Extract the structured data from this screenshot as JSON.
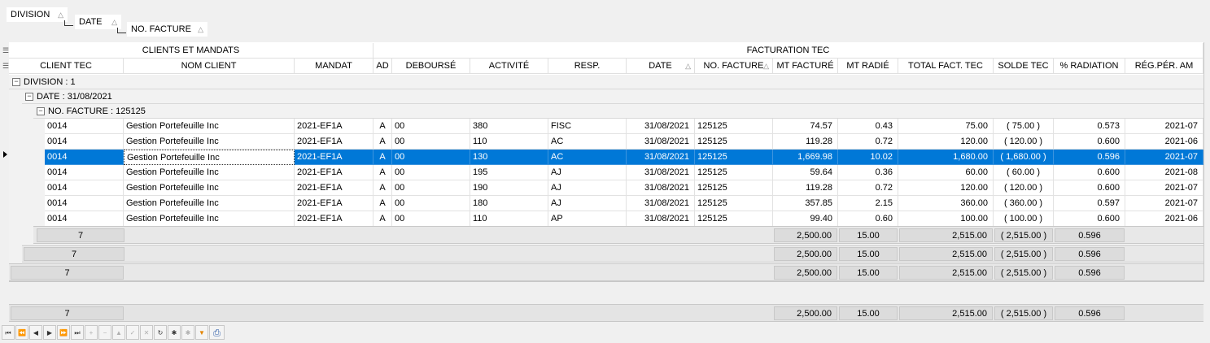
{
  "group_panel": {
    "division": "DIVISION",
    "date": "DATE",
    "no_facture": "NO. FACTURE"
  },
  "bands": {
    "clients": "CLIENTS ET MANDATS",
    "facturation": "FACTURATION TEC"
  },
  "columns": {
    "client_tec": "CLIENT TEC",
    "nom_client": "NOM CLIENT",
    "mandat": "MANDAT",
    "ad": "AD",
    "debourse": "DEBOURSÉ",
    "activite": "ACTIVITÉ",
    "resp": "RESP.",
    "date": "DATE",
    "no_facture": "NO. FACTURE",
    "mt_facture": "MT FACTURÉ",
    "mt_radie": "MT RADIÉ",
    "total_fact": "TOTAL FACT. TEC",
    "solde": "SOLDE TEC",
    "radiation": "% RADIATION",
    "reg_per": "RÉG.PÉR. AM"
  },
  "groups": {
    "division": "DIVISION : 1",
    "date": "DATE : 31/08/2021",
    "no_facture": "NO. FACTURE : 125125"
  },
  "rows": [
    [
      "0014",
      "Gestion Portefeuille Inc",
      "2021-EF1A",
      "A",
      "00",
      "380",
      "FISC",
      "31/08/2021",
      "125125",
      "74.57",
      "0.43",
      "75.00",
      "( 75.00 )",
      "0.573",
      "2021-07"
    ],
    [
      "0014",
      "Gestion Portefeuille Inc",
      "2021-EF1A",
      "A",
      "00",
      "110",
      "AC",
      "31/08/2021",
      "125125",
      "119.28",
      "0.72",
      "120.00",
      "( 120.00 )",
      "0.600",
      "2021-06"
    ],
    [
      "0014",
      "Gestion Portefeuille Inc",
      "2021-EF1A",
      "A",
      "00",
      "130",
      "AC",
      "31/08/2021",
      "125125",
      "1,669.98",
      "10.02",
      "1,680.00",
      "( 1,680.00 )",
      "0.596",
      "2021-07"
    ],
    [
      "0014",
      "Gestion Portefeuille Inc",
      "2021-EF1A",
      "A",
      "00",
      "195",
      "AJ",
      "31/08/2021",
      "125125",
      "59.64",
      "0.36",
      "60.00",
      "( 60.00 )",
      "0.600",
      "2021-08"
    ],
    [
      "0014",
      "Gestion Portefeuille Inc",
      "2021-EF1A",
      "A",
      "00",
      "190",
      "AJ",
      "31/08/2021",
      "125125",
      "119.28",
      "0.72",
      "120.00",
      "( 120.00 )",
      "0.600",
      "2021-07"
    ],
    [
      "0014",
      "Gestion Portefeuille Inc",
      "2021-EF1A",
      "A",
      "00",
      "180",
      "AJ",
      "31/08/2021",
      "125125",
      "357.85",
      "2.15",
      "360.00",
      "( 360.00 )",
      "0.597",
      "2021-07"
    ],
    [
      "0014",
      "Gestion Portefeuille Inc",
      "2021-EF1A",
      "A",
      "00",
      "110",
      "AP",
      "31/08/2021",
      "125125",
      "99.40",
      "0.60",
      "100.00",
      "( 100.00 )",
      "0.600",
      "2021-06"
    ]
  ],
  "summary": {
    "count": "7",
    "mt_facture": "2,500.00",
    "mt_radie": "15.00",
    "total_fact": "2,515.00",
    "solde": "( 2,515.00 )",
    "radiation": "0.596"
  }
}
